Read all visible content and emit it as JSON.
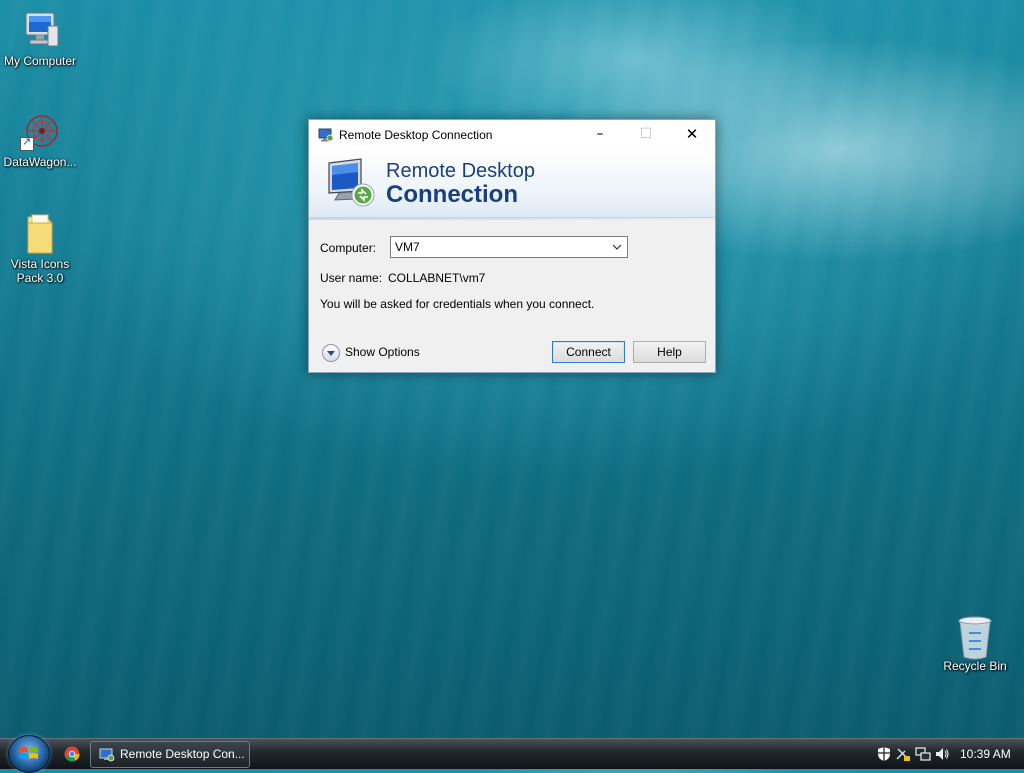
{
  "desktop": {
    "icons": [
      {
        "label": "My Computer",
        "icon": "computer-icon"
      },
      {
        "label": "DataWagon...",
        "icon": "datawagon-icon"
      },
      {
        "label": "Vista Icons Pack 3.0",
        "icon": "folder-icon"
      },
      {
        "label": "Recycle Bin",
        "icon": "recycle-bin-icon"
      }
    ]
  },
  "dialog": {
    "title": "Remote Desktop Connection",
    "banner_line1": "Remote Desktop",
    "banner_line2": "Connection",
    "computer_label": "Computer:",
    "computer_value": "VM7",
    "username_label": "User name:",
    "username_value": "COLLABNET\\vm7",
    "info_text": "You will be asked for credentials when you connect.",
    "show_options_label": "Show Options",
    "connect_label": "Connect",
    "help_label": "Help",
    "minimize_symbol": "–",
    "maximize_symbol": "☐",
    "close_symbol": "✕"
  },
  "taskbar": {
    "task_label": "Remote Desktop Con...",
    "clock": "10:39 AM",
    "tray_icons": [
      "action-center-icon",
      "network-muted-icon",
      "network-icon",
      "volume-icon"
    ]
  },
  "colors": {
    "banner_text": "#1a3f80",
    "default_button_border": "#2d7ad6"
  }
}
